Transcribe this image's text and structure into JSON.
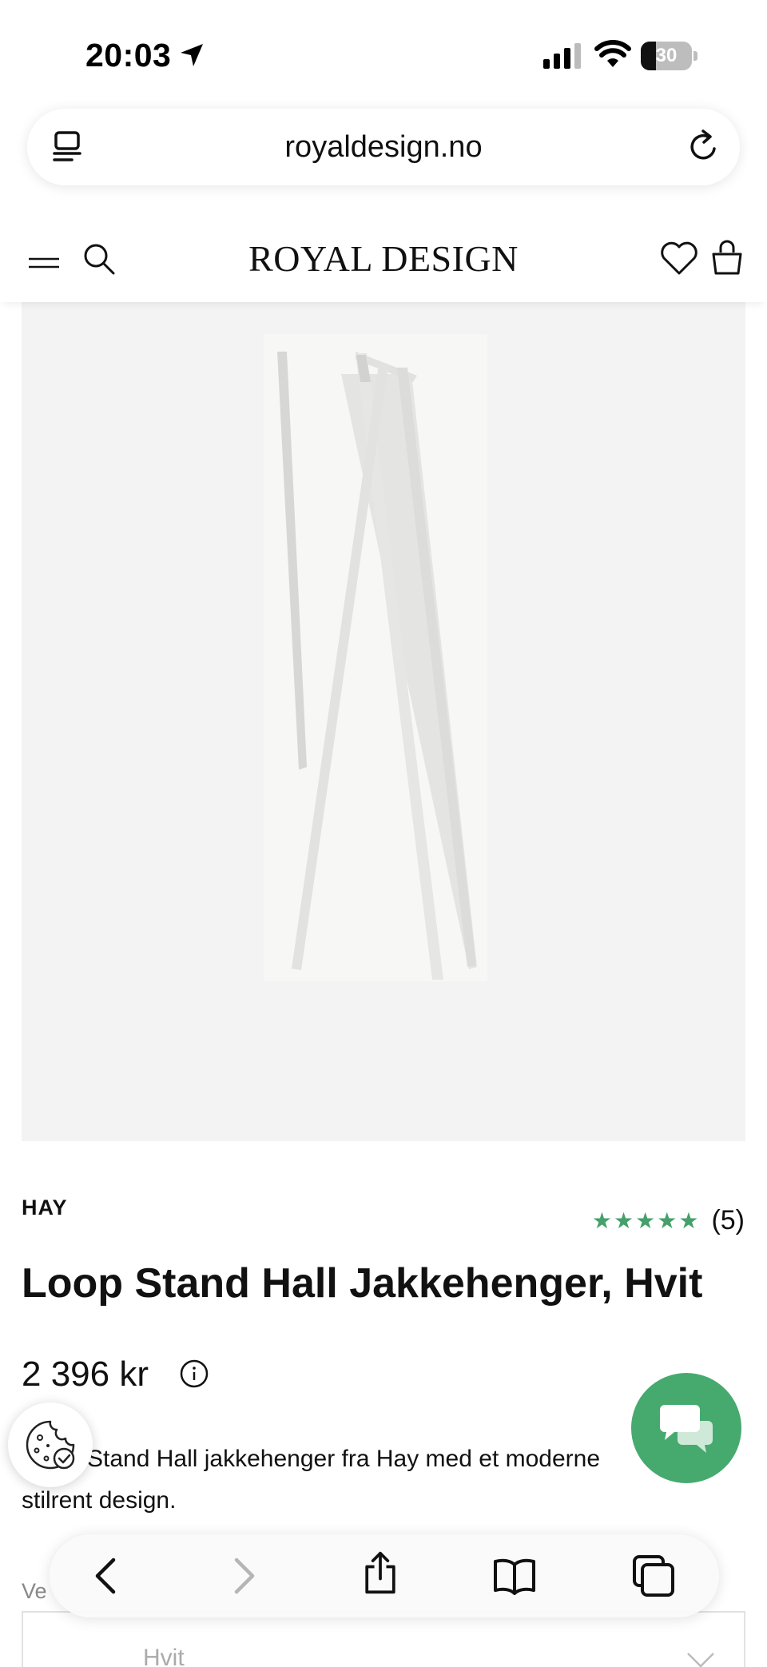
{
  "status_bar": {
    "time": "20:03",
    "battery_percent": "30",
    "battery_level": 0.3
  },
  "browser": {
    "url": "royaldesign.no"
  },
  "site_header": {
    "logo": "ROYAL DESIGN",
    "icons": [
      "menu-icon",
      "search-icon",
      "heart-icon",
      "shopping-bag-icon"
    ]
  },
  "product": {
    "brand": "HAY",
    "rating_stars": "★★★★★",
    "rating_value": 5,
    "review_count": "(5)",
    "title": "Loop Stand Hall Jakkehenger, Hvit",
    "price": "2 396 kr",
    "description": "Stand Hall jakkehenger fra Hay med et moderne stilrent design.",
    "variant_label": "Ve",
    "variant_value": "Hvit"
  },
  "floating": {
    "chat_color": "#46aa6f",
    "star_color": "#45a06b"
  }
}
